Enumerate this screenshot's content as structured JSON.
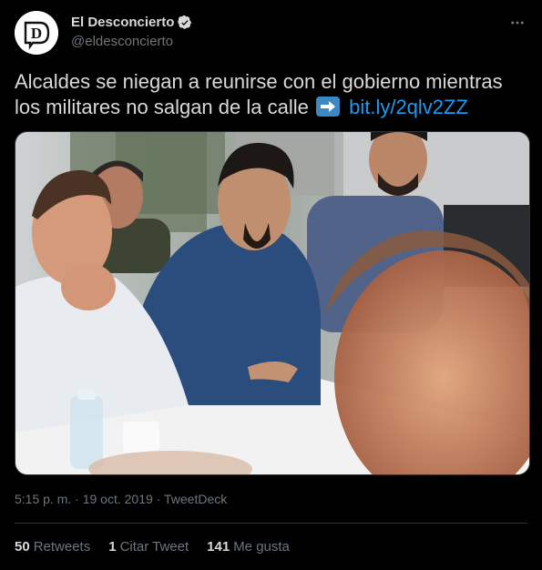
{
  "header": {
    "display_name": "El Desconcierto",
    "handle": "@eldesconcierto",
    "avatar_letter": "D",
    "verified": true
  },
  "tweet": {
    "line1": "Alcaldes se niegan a reunirse con el gobierno mientras",
    "line2": "los militares no salgan de la calle",
    "emoji": "right-arrow-emoji",
    "link": "bit.ly/2qlv2ZZ"
  },
  "meta": {
    "time": "5:15 p. m.",
    "sep1": " · ",
    "date": "19 oct. 2019",
    "sep2": " · ",
    "source": "TweetDeck"
  },
  "stats": {
    "retweets_count": "50",
    "retweets_label": "Retweets",
    "quotes_count": "1",
    "quotes_label": "Citar Tweet",
    "likes_count": "141",
    "likes_label": "Me gusta"
  },
  "colors": {
    "background": "#000000",
    "text": "#d9d9d9",
    "muted": "#6e767d",
    "link": "#1d9bf0",
    "divider": "#2f3336"
  },
  "icons": [
    "verified-badge-icon",
    "more-options-icon",
    "right-arrow-emoji"
  ]
}
